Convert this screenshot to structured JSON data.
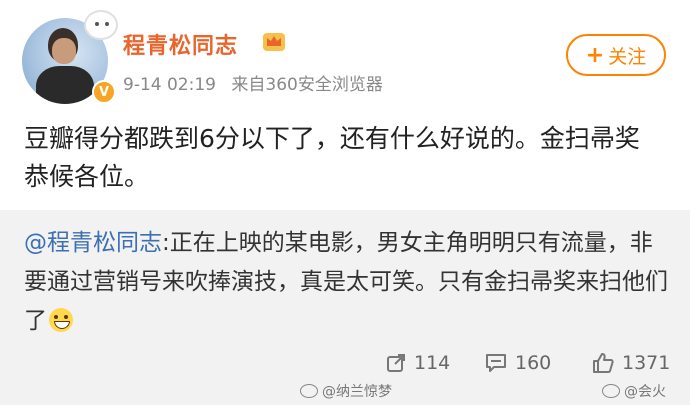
{
  "post": {
    "username": "程青松同志",
    "time": "9-14 02:19",
    "source": "来自360安全浏览器",
    "follow_label": "关注",
    "content": "豆瓣得分都跌到6分以下了，还有什么好说的。金扫帚奖恭候各位。",
    "verified_badge": "V"
  },
  "repost": {
    "mention": "@程青松同志",
    "text": ":正在上映的某电影，男女主角明明只有流量，非要通过营销号来吹捧演技，真是太可笑。只有金扫帚奖来扫他们了",
    "share_count": "114",
    "comment_count": "160",
    "like_count": "1371"
  },
  "watermarks": [
    "@纳兰惊梦",
    "@会火"
  ],
  "colors": {
    "username": "#e8662d",
    "follow": "#ff8200",
    "mention": "#3d6fb4",
    "repost_bg": "#f2f2f2"
  },
  "icons": [
    "crown-icon",
    "share-icon",
    "comment-icon",
    "like-icon",
    "grin-emoji-icon",
    "weibo-watermark-icon"
  ]
}
